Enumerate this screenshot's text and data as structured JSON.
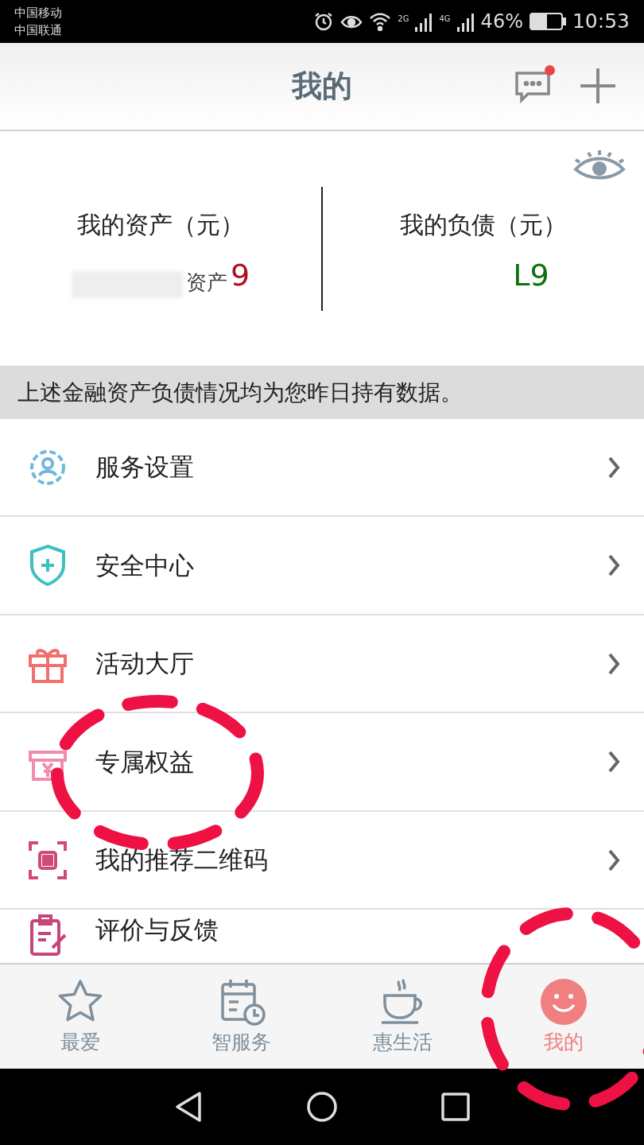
{
  "status_bar": {
    "carriers": [
      "中国移动",
      "中国联通"
    ],
    "network_1": "2G",
    "network_2": "4G",
    "battery": "46%",
    "time": "10:53"
  },
  "header": {
    "title": "我的",
    "has_unread": true
  },
  "summary": {
    "assets": {
      "label": "我的资产（元）",
      "value": "9",
      "overlay": "资产"
    },
    "liabilities": {
      "label": "我的负债（元）",
      "value": "L9"
    }
  },
  "notice": "上述金融资产负债情况均为您昨日持有数据。",
  "menu": [
    {
      "kind": "gear",
      "label": "服务设置"
    },
    {
      "kind": "shield",
      "label": "安全中心"
    },
    {
      "kind": "gift",
      "label": "活动大厅"
    },
    {
      "kind": "yen",
      "label": "专属权益"
    },
    {
      "kind": "qr",
      "label": "我的推荐二维码"
    },
    {
      "kind": "clipboard",
      "label": "评价与反馈"
    }
  ],
  "tabs": [
    {
      "kind": "star",
      "label": "最爱",
      "selected": false
    },
    {
      "kind": "calendar",
      "label": "智服务",
      "selected": false
    },
    {
      "kind": "cup",
      "label": "惠生活",
      "selected": false
    },
    {
      "kind": "smile",
      "label": "我的",
      "selected": true
    }
  ]
}
